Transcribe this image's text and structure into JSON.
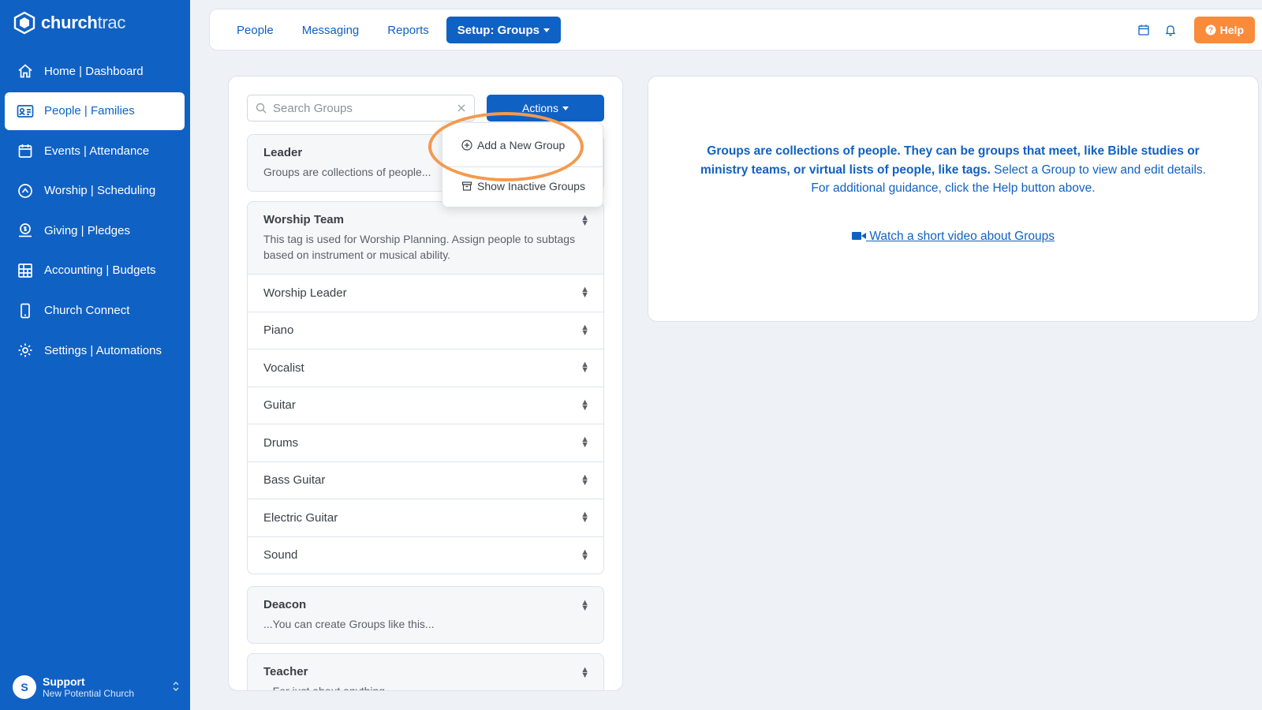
{
  "brand": {
    "name_bold": "church",
    "name_light": "trac"
  },
  "sidebar": {
    "items": [
      {
        "label": "Home | Dashboard",
        "icon": "home-icon"
      },
      {
        "label": "People | Families",
        "icon": "id-card-icon",
        "active": true
      },
      {
        "label": "Events | Attendance",
        "icon": "calendar-icon"
      },
      {
        "label": "Worship | Scheduling",
        "icon": "music-icon"
      },
      {
        "label": "Giving | Pledges",
        "icon": "donation-icon"
      },
      {
        "label": "Accounting | Budgets",
        "icon": "grid-icon"
      },
      {
        "label": "Church Connect",
        "icon": "phone-icon"
      },
      {
        "label": "Settings | Automations",
        "icon": "gear-icon"
      }
    ],
    "user": {
      "initial": "S",
      "name": "Support",
      "church": "New Potential Church"
    }
  },
  "topbar": {
    "tabs": [
      {
        "label": "People"
      },
      {
        "label": "Messaging"
      },
      {
        "label": "Reports"
      },
      {
        "label": "Setup: Groups",
        "active": true
      }
    ],
    "help_label": "Help"
  },
  "groups_panel": {
    "search_placeholder": "Search Groups",
    "actions_label": "Actions",
    "dropdown": {
      "add_label": "Add a New Group",
      "inactive_label": "Show Inactive Groups"
    },
    "leader": {
      "title": "Leader",
      "desc": "Groups are collections of people..."
    },
    "worship_team": {
      "title": "Worship Team",
      "desc": "This tag is used for Worship Planning. Assign people to subtags based on instrument or musical ability.",
      "subgroups": [
        "Worship Leader",
        "Piano",
        "Vocalist",
        "Guitar",
        "Drums",
        "Bass Guitar",
        "Electric Guitar",
        "Sound"
      ]
    },
    "deacon": {
      "title": "Deacon",
      "desc": "...You can create Groups like this..."
    },
    "teacher": {
      "title": "Teacher",
      "desc": "...For just about anything"
    }
  },
  "info_panel": {
    "bold_text": "Groups are collections of people. They can be groups that meet, like Bible studies or ministry teams, or virtual lists of people, like tags.",
    "normal_text": "Select a Group to view and edit details. For additional guidance, click the Help button above.",
    "video_link": "Watch a short video about Groups"
  },
  "colors": {
    "primary": "#1061c4",
    "accent": "#f98b3a",
    "highlight_ring": "#f39a4f"
  }
}
